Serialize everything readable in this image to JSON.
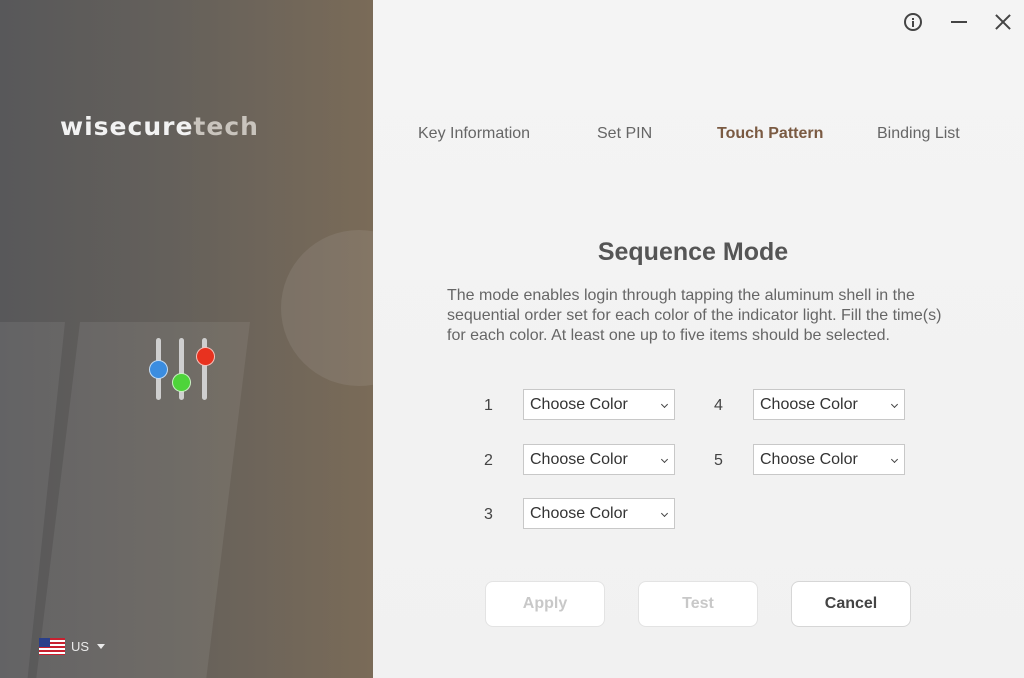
{
  "brand": {
    "logo_part1": "wisecure",
    "logo_part2": "tech"
  },
  "locale": {
    "label": "US",
    "flag_icon": "us-flag-icon"
  },
  "window_controls": {
    "info_icon": "info-icon",
    "minimize_icon": "minimize-icon",
    "close_icon": "close-icon"
  },
  "tabs": [
    {
      "label": "Key Information",
      "active": false
    },
    {
      "label": "Set PIN",
      "active": false
    },
    {
      "label": "Touch Pattern",
      "active": true
    },
    {
      "label": "Binding List",
      "active": false
    }
  ],
  "main": {
    "title": "Sequence Mode",
    "description": "The mode enables login through tapping the aluminum shell in the sequential order set for each color of the indicator light. Fill the time(s) for each color. At least one up to five items should be selected."
  },
  "slots": [
    {
      "number": "1",
      "value": "Choose Color"
    },
    {
      "number": "2",
      "value": "Choose Color"
    },
    {
      "number": "3",
      "value": "Choose Color"
    },
    {
      "number": "4",
      "value": "Choose Color"
    },
    {
      "number": "5",
      "value": "Choose Color"
    }
  ],
  "buttons": {
    "apply": {
      "label": "Apply",
      "enabled": false
    },
    "test": {
      "label": "Test",
      "enabled": false
    },
    "cancel": {
      "label": "Cancel",
      "enabled": true
    }
  },
  "colors": {
    "accent_tab": "#7a5a42",
    "knob_blue": "#3b8de0",
    "knob_green": "#4ed43a",
    "knob_red": "#e8321f"
  }
}
